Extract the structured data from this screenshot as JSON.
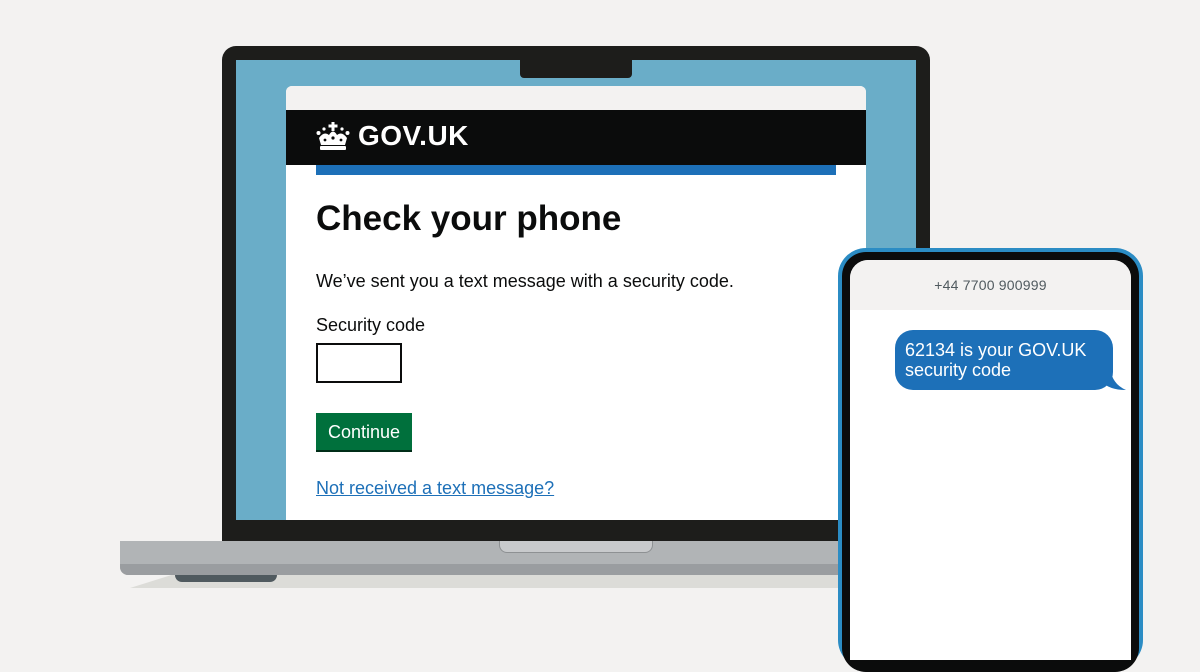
{
  "laptop": {
    "browser": {
      "header": {
        "logo_text": "GOV.UK",
        "logo_icon": "crown-icon"
      },
      "page": {
        "title": "Check your phone",
        "lead": "We’ve sent you a text message with a security code.",
        "field_label": "Security code",
        "field_value": "",
        "button_label": "Continue",
        "help_link": "Not received a text message?"
      }
    }
  },
  "phone": {
    "sender": "+44 7700 900999",
    "message": "62134 is your GOV.UK security code"
  },
  "colors": {
    "background": "#f3f2f1",
    "header_black": "#0b0c0c",
    "brand_blue": "#1d70b8",
    "button_green": "#00703c",
    "screen_blue": "#6aadc8"
  }
}
